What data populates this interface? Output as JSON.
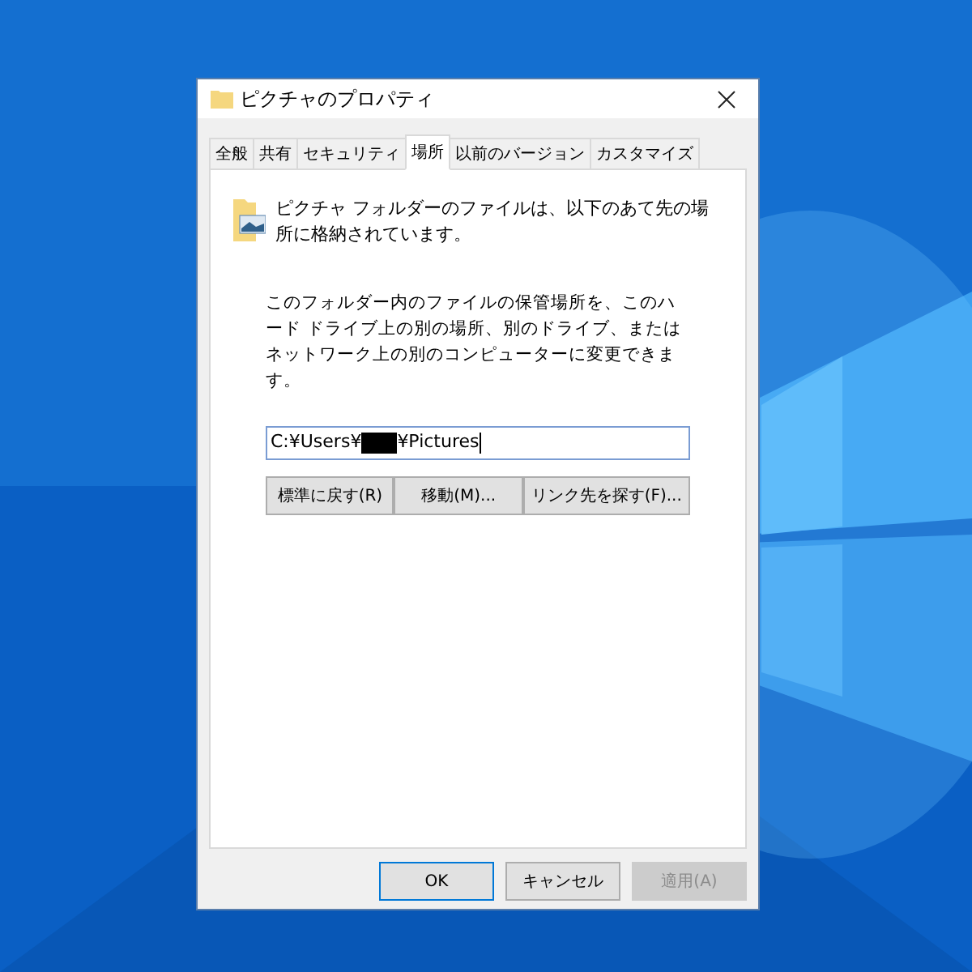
{
  "window": {
    "title": "ピクチャのプロパティ"
  },
  "tabs": [
    {
      "label": "全般",
      "selected": false
    },
    {
      "label": "共有",
      "selected": false
    },
    {
      "label": "セキュリティ",
      "selected": false
    },
    {
      "label": "場所",
      "selected": true
    },
    {
      "label": "以前のバージョン",
      "selected": false
    },
    {
      "label": "カスタマイズ",
      "selected": false
    }
  ],
  "header_text": "ピクチャ フォルダーのファイルは、以下のあて先の場所に格納されています。",
  "description": "このフォルダー内のファイルの保管場所を、このハード ドライブ上の別の場所、別のドライブ、またはネットワーク上の別のコンピューターに変更できます。",
  "path_field": {
    "value_start": "C:¥Users¥",
    "redacted": true,
    "value_end": "¥Pictures"
  },
  "location_buttons": [
    {
      "label": "標準に戻す(R)",
      "disabled": false
    },
    {
      "label": "移動(M)...",
      "disabled": false
    },
    {
      "label": "リンク先を探す(F)...",
      "disabled": false
    }
  ],
  "dialog_buttons": [
    {
      "label": "OK",
      "disabled": false,
      "default": true
    },
    {
      "label": "キャンセル",
      "disabled": false,
      "default": false
    },
    {
      "label": "適用(A)",
      "disabled": true,
      "default": false
    }
  ]
}
